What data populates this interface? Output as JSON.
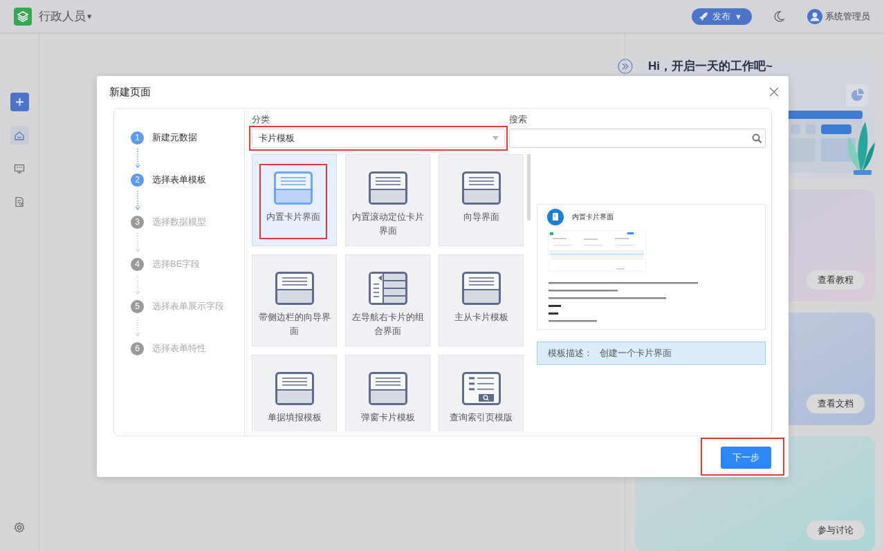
{
  "app": {
    "title": "行政人员",
    "caret": "▾"
  },
  "publish_button": {
    "label": "发布",
    "caret": "▼"
  },
  "user": {
    "name": "系统管理员"
  },
  "sidebar": {
    "items": [
      {
        "selected": true
      },
      {
        "selected": false
      },
      {
        "selected": false
      }
    ]
  },
  "right_panel": {
    "greeting": "Hi，开启一天的工作吧~",
    "buttons": [
      "查看教程",
      "查看文档",
      "参与讨论"
    ]
  },
  "dialog": {
    "title": "新建页面",
    "steps": [
      {
        "number": "1",
        "label": "新建元数据",
        "active": true
      },
      {
        "number": "2",
        "label": "选择表单模板",
        "active": true
      },
      {
        "number": "3",
        "label": "选择数据模型",
        "active": false
      },
      {
        "number": "4",
        "label": "选择BE字段",
        "active": false
      },
      {
        "number": "5",
        "label": "选择表单展示字段",
        "active": false
      },
      {
        "number": "6",
        "label": "选择表单特性",
        "active": false
      }
    ],
    "category": {
      "label": "分类",
      "value": "卡片模板",
      "highlighted": true
    },
    "search": {
      "label": "搜索"
    },
    "templates": [
      {
        "label": "内置卡片界面",
        "kind": "card",
        "selected": true,
        "highlighted": true
      },
      {
        "label": "内置滚动定位卡片界面",
        "kind": "card",
        "selected": false,
        "highlighted": false
      },
      {
        "label": "向导界面",
        "kind": "card",
        "selected": false,
        "highlighted": false
      },
      {
        "label": "带侧边栏的向导界面",
        "kind": "card",
        "selected": false,
        "highlighted": false
      },
      {
        "label": "左导航右卡片的组合界面",
        "kind": "nav",
        "selected": false,
        "highlighted": false
      },
      {
        "label": "主从卡片模板",
        "kind": "card",
        "selected": false,
        "highlighted": false
      },
      {
        "label": "单据填报模板",
        "kind": "card",
        "selected": false,
        "highlighted": false
      },
      {
        "label": "弹窗卡片模板",
        "kind": "card",
        "selected": false,
        "highlighted": false
      },
      {
        "label": "查询索引页模版",
        "kind": "query",
        "selected": false,
        "highlighted": false
      }
    ],
    "preview": {
      "title": "内置卡片界面"
    },
    "description": {
      "label": "模板描述：",
      "value": "创建一个卡片界面"
    },
    "next_button": {
      "label": "下一步",
      "highlighted": true
    }
  }
}
